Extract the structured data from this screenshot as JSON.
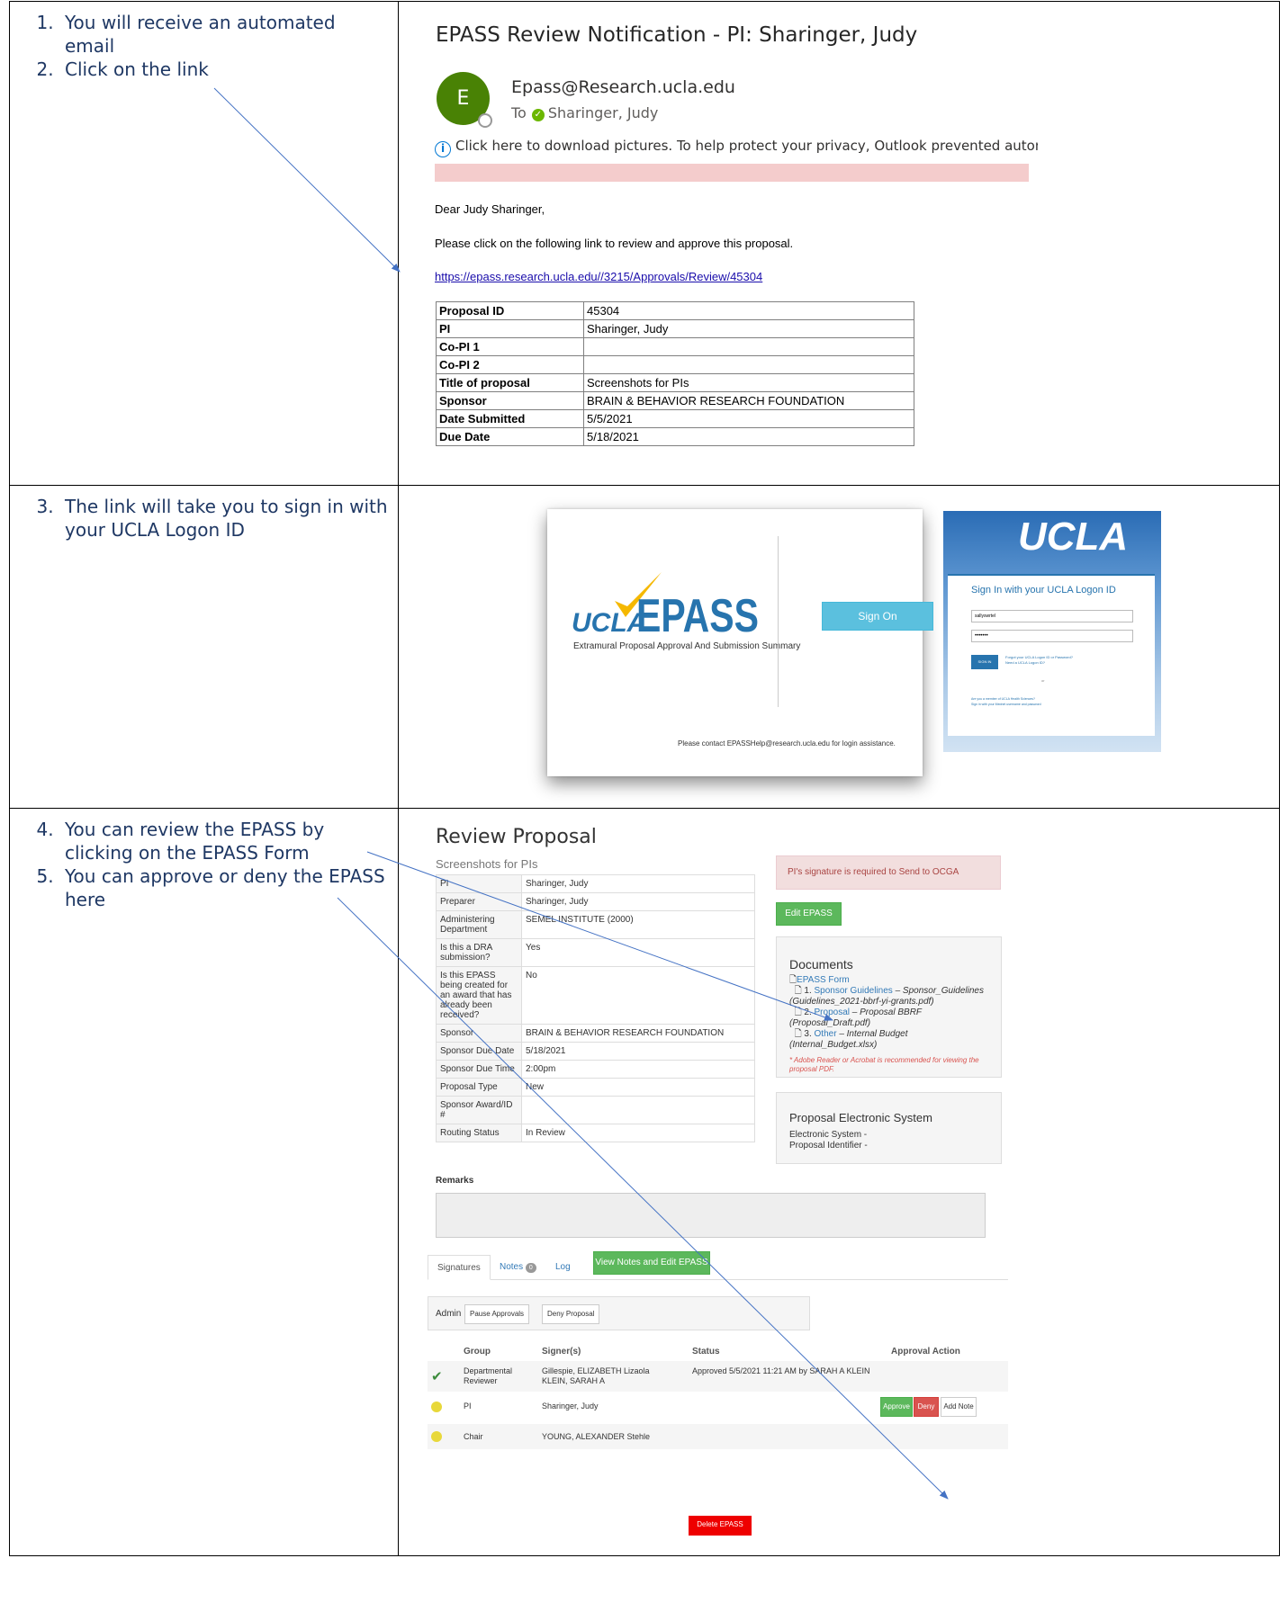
{
  "steps": {
    "s1": "You will receive an automated email",
    "s2": "Click on the link",
    "s3": "The link will take you to sign in with your UCLA Logon ID",
    "s4": "You can review the EPASS by clicking on the EPASS Form",
    "s5": "You can approve or deny the EPASS here"
  },
  "email": {
    "subject": "EPASS Review Notification - PI: Sharinger, Judy",
    "avatar_letter": "E",
    "sender": "Epass@Research.ucla.edu",
    "to_label": "To",
    "to_name": "Sharinger, Judy",
    "info": "Click here to download pictures. To help protect your privacy, Outlook prevented automatic download of some pictures in this message.",
    "greeting": "Dear Judy Sharinger,",
    "body": "Please click on the following link to review and approve this proposal.",
    "link": "https://epass.research.ucla.edu//3215/Approvals/Review/45304",
    "rows": [
      {
        "k": "Proposal ID",
        "v": "45304"
      },
      {
        "k": "PI",
        "v": "Sharinger, Judy"
      },
      {
        "k": "Co-PI 1",
        "v": ""
      },
      {
        "k": "Co-PI 2",
        "v": ""
      },
      {
        "k": "Title of proposal",
        "v": "Screenshots for PIs"
      },
      {
        "k": "Sponsor",
        "v": "BRAIN & BEHAVIOR RESEARCH FOUNDATION"
      },
      {
        "k": "Date Submitted",
        "v": "5/5/2021"
      },
      {
        "k": "Due Date",
        "v": "5/18/2021"
      }
    ]
  },
  "login": {
    "logo_ucla": "UCLA",
    "logo_epass": "EPASS",
    "logo_sub": "Extramural Proposal Approval And Submission Summary",
    "sign_on": "Sign On",
    "contact": "Please contact EPASSHelp@research.ucla.edu for login assistance.",
    "ucla_title": "UCLA",
    "form_title": "Sign In with your UCLA Logon ID",
    "username": "sallyswrtel",
    "password": "•••••••",
    "sign_in": "SIGN IN",
    "link1": "Forgot your UCLA Logon ID or Password?",
    "link2": "Need a UCLA Logon ID?",
    "or": "or",
    "foot1": "Are you a member of UCLA Health Sciences?",
    "foot2": "Sign in with your Mednet username and password"
  },
  "review": {
    "title": "Review Proposal",
    "subtitle": "Screenshots for PIs",
    "rows": [
      {
        "k": "PI",
        "v": "Sharinger, Judy"
      },
      {
        "k": "Preparer",
        "v": "Sharinger, Judy"
      },
      {
        "k": "Administering Department",
        "v": "SEMEL INSTITUTE (2000)"
      },
      {
        "k": "Is this a DRA submission?",
        "v": "Yes"
      },
      {
        "k": "Is this EPASS being created for an award that has already been received?",
        "v": "No"
      },
      {
        "k": "Sponsor",
        "v": "BRAIN & BEHAVIOR RESEARCH FOUNDATION"
      },
      {
        "k": "Sponsor Due Date",
        "v": "5/18/2021"
      },
      {
        "k": "Sponsor Due Time",
        "v": "2:00pm"
      },
      {
        "k": "Proposal Type",
        "v": "New"
      },
      {
        "k": "Sponsor Award/ID #",
        "v": ""
      },
      {
        "k": "Routing Status",
        "v": "In Review"
      }
    ],
    "alert": "PI's signature is required to Send to OCGA",
    "edit_epass": "Edit EPASS",
    "docs_title": "Documents",
    "doc_epass_form": "EPASS Form",
    "doc1_prefix": "1.",
    "doc1_link": "Sponsor Guidelines",
    "doc1_desc": "– Sponsor_Guidelines (Guidelines_2021-bbrf-yi-grants.pdf)",
    "doc2_prefix": "2.",
    "doc2_link": "Proposal",
    "doc2_desc": "– Proposal BBRF (Proposal_Draft.pdf)",
    "doc3_prefix": "3.",
    "doc3_link": "Other",
    "doc3_desc": "– Internal Budget (Internal_Budget.xlsx)",
    "docs_note": "* Adobe Reader or Acrobat is recommended for viewing the proposal PDF.",
    "pes_title": "Proposal Electronic System",
    "pes_line1": "Electronic System -",
    "pes_line2": "Proposal Identifier -",
    "remarks_label": "Remarks",
    "tab_signatures": "Signatures",
    "tab_notes": "Notes",
    "notes_count": "0",
    "tab_log": "Log",
    "view_notes": "View Notes and Edit EPASS",
    "admin_label": "Admin",
    "pause_approvals": "Pause Approvals",
    "deny_proposal": "Deny Proposal",
    "col_group": "Group",
    "col_signers": "Signer(s)",
    "col_status": "Status",
    "col_action": "Approval Action",
    "sig1_group": "Departmental Reviewer",
    "sig1_signers": "Gillespie, ELIZABETH Lizaola KLEIN, SARAH A",
    "sig1_status": "Approved 5/5/2021 11:21 AM by SARAH A KLEIN",
    "sig2_group": "PI",
    "sig2_signers": "Sharinger, Judy",
    "approve": "Approve",
    "deny": "Deny",
    "add_note": "Add Note",
    "sig3_group": "Chair",
    "sig3_signers": "YOUNG, ALEXANDER Stehle",
    "delete_epass": "Delete EPASS"
  }
}
